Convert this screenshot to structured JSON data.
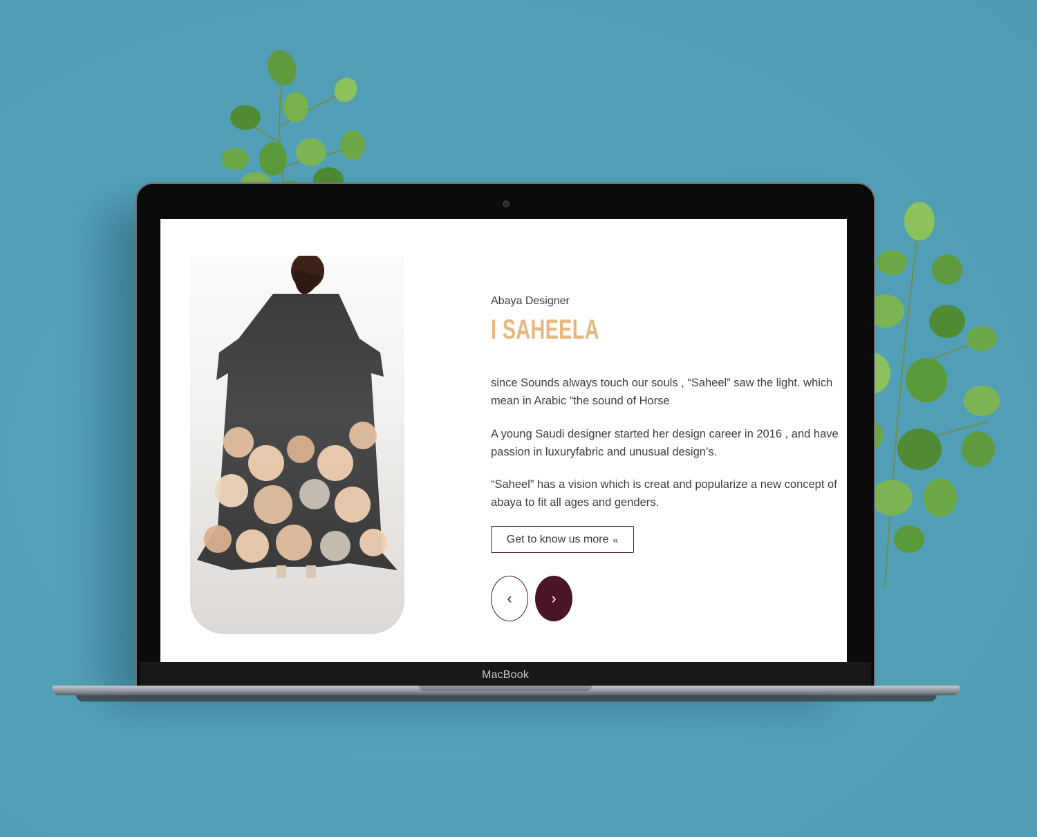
{
  "laptop": {
    "brand_label": "MacBook"
  },
  "hero": {
    "eyebrow": "Abaya Designer",
    "title": "I SAHEELA",
    "paragraphs": [
      "since Sounds always touch our souls , “Saheel” saw the light. which mean in Arabic “the sound of Horse",
      "A young Saudi designer started her design career in 2016 , and have passion in luxuryfabric and unusual design’s.",
      "“Saheel” has a vision which is creat and popularize a new concept of abaya to fit all ages and genders."
    ],
    "cta_label": "Get to know us more",
    "cta_icon": "double-chevron-left-icon",
    "prev_icon": "‹",
    "next_icon": "›"
  },
  "colors": {
    "background": "#54a5bd",
    "title": "#e6b87f",
    "accent": "#4a1626",
    "text": "#3d3d3d"
  }
}
